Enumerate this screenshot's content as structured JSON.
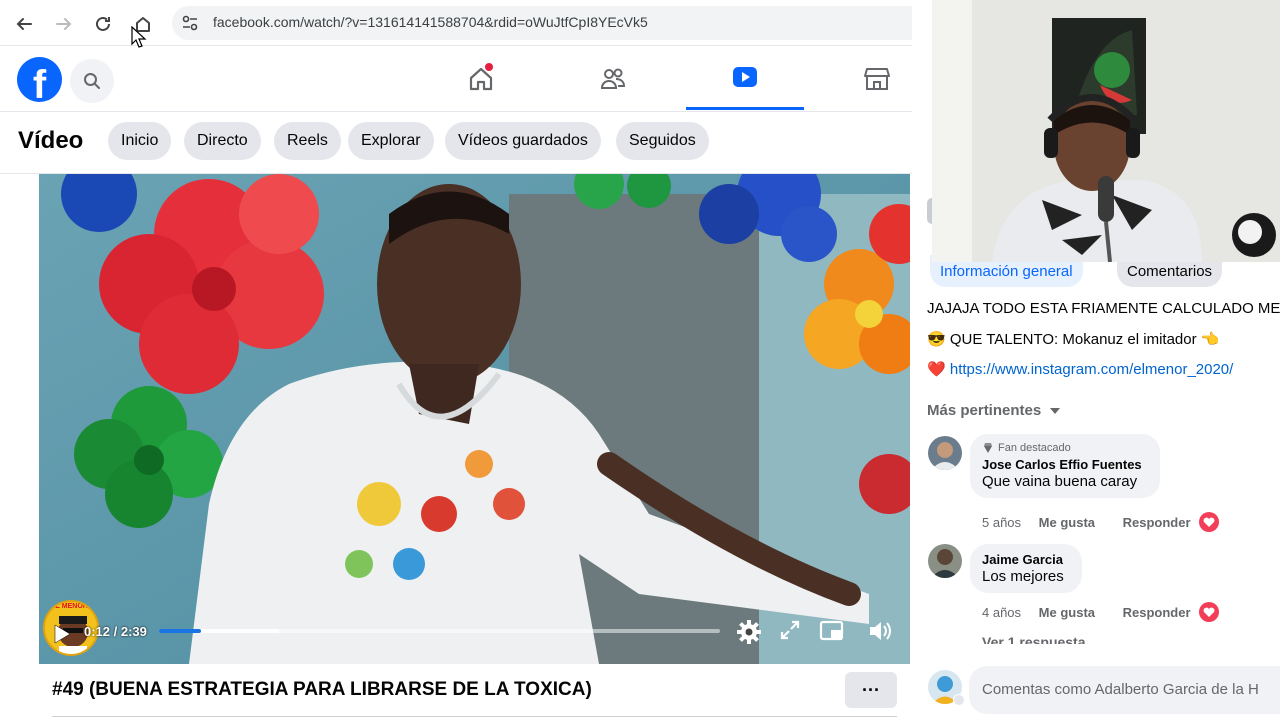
{
  "browser": {
    "url": "facebook.com/watch/?v=131614141588704&rdid=oWuJtfCpI8YEcVk5"
  },
  "header": {
    "logo_letter": "f",
    "tabs": [
      "home",
      "friends",
      "video",
      "marketplace"
    ],
    "active_tab": "video"
  },
  "video_nav": {
    "title": "Vídeo",
    "pills": [
      "Inicio",
      "Directo",
      "Reels",
      "Explorar",
      "Vídeos guardados",
      "Seguidos"
    ]
  },
  "player": {
    "time": "0:12 / 2:39",
    "progress_fraction": 0.075,
    "badge_text": "EL MENOR"
  },
  "video": {
    "title": "#49 (BUENA ESTRATEGIA PARA LIBRARSE DE LA TOXICA)",
    "more_label": "···"
  },
  "right": {
    "tabs": [
      "Información general",
      "Comentarios"
    ],
    "active_tab": "Información general",
    "desc_line1": "JAJAJA TODO ESTA FRIAMENTE CALCULADO ME",
    "desc_line2_emoji": "😎",
    "desc_line2": "QUE TALENTO: Mokanuz el imitador 👈",
    "desc_line3_emoji": "❤️",
    "desc_link": "https://www.instagram.com/elmenor_2020/",
    "sort_label": "Más pertinentes",
    "comments": [
      {
        "badge": "Fan destacado",
        "name": "Jose Carlos Effio Fuentes",
        "text": "Que vaina buena caray",
        "age": "5 años",
        "like": "Me gusta",
        "reply": "Responder"
      },
      {
        "badge": "",
        "name": "Jaime Garcia",
        "text": "Los mejores",
        "age": "4 años",
        "like": "Me gusta",
        "reply": "Responder"
      }
    ],
    "replies_link": "Ver 1 respuesta",
    "composer_placeholder": "Comentas como Adalberto Garcia de la H"
  },
  "colors": {
    "brand": "#0866ff",
    "reaction_heart": "#f33e58",
    "link": "#0064d1"
  }
}
